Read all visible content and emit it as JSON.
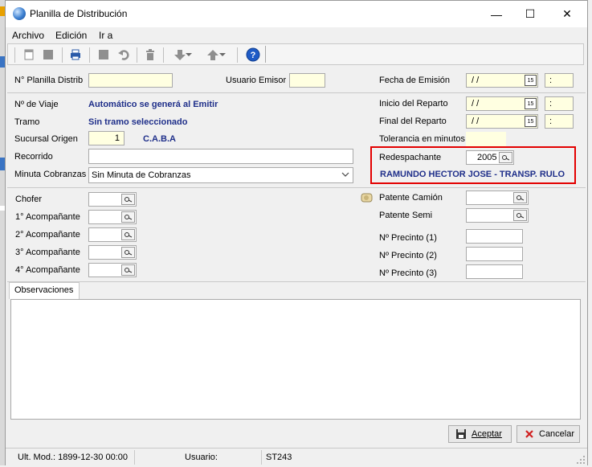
{
  "window": {
    "title": "Planilla de Distribución",
    "controls": {
      "minimize": "—",
      "maximize": "☐",
      "close": "✕"
    }
  },
  "menu": [
    {
      "label": "Archivo"
    },
    {
      "label": "Edición"
    },
    {
      "label": "Ir a"
    }
  ],
  "toolbar_icons": [
    "new-icon",
    "save-icon",
    "print-icon",
    "stop-icon",
    "undo-icon",
    "delete-icon",
    "arrow-down-icon",
    "arrow-up-icon",
    "help-icon"
  ],
  "form": {
    "planilla_label": "N° Planilla Distrib",
    "planilla_value": "",
    "usuario_emisor_label": "Usuario Emisor",
    "usuario_emisor_value": "",
    "fecha_emision_label": "Fecha de Emisión",
    "fecha_emision_value": " / /",
    "fecha_emision_time": ":",
    "viaje_label": "Nº de Viaje",
    "viaje_value": "Automático se generá al Emitir",
    "inicio_reparto_label": "Inicio del Reparto",
    "inicio_reparto_value": " / /",
    "inicio_reparto_time": ":",
    "tramo_label": "Tramo",
    "tramo_value": "Sin tramo seleccionado",
    "final_reparto_label": "Final del Reparto",
    "final_reparto_value": " / /",
    "final_reparto_time": ":",
    "sucursal_label": "Sucursal Origen",
    "sucursal_value": "1",
    "sucursal_name": "C.A.B.A",
    "tolerancia_label": "Tolerancia en minutos",
    "tolerancia_value": "",
    "recorrido_label": "Recorrido",
    "recorrido_value": "",
    "redespachante_label": "Redespachante",
    "redespachante_value": "2005",
    "redespachante_name": "RAMUNDO HECTOR JOSE - TRANSP. RULO",
    "minuta_label": "Minuta Cobranzas",
    "minuta_value": "Sin Minuta de Cobranzas",
    "chofer_label": "Chofer",
    "acomp1_label": "1° Acompañante",
    "acomp2_label": "2° Acompañante",
    "acomp3_label": "3° Acompañante",
    "acomp4_label": "4° Acompañante",
    "patente_camion_label": "Patente Camión",
    "patente_semi_label": "Patente Semi",
    "precinto1_label": "Nº Precinto (1)",
    "precinto2_label": "Nº Precinto (2)",
    "precinto3_label": "Nº Precinto (3)"
  },
  "tabs": [
    {
      "label": "Observaciones"
    }
  ],
  "observaciones_value": "",
  "buttons": {
    "accept": "Aceptar",
    "cancel": "Cancelar"
  },
  "status": {
    "ult_mod": "Ult. Mod.: 1899-12-30 00:00",
    "usuario_label": "Usuario:",
    "usuario_value": "ST243"
  },
  "colors": {
    "highlight": "#e30000",
    "input_yellow": "#ffffe1",
    "label_blue": "#1f2f8a"
  }
}
